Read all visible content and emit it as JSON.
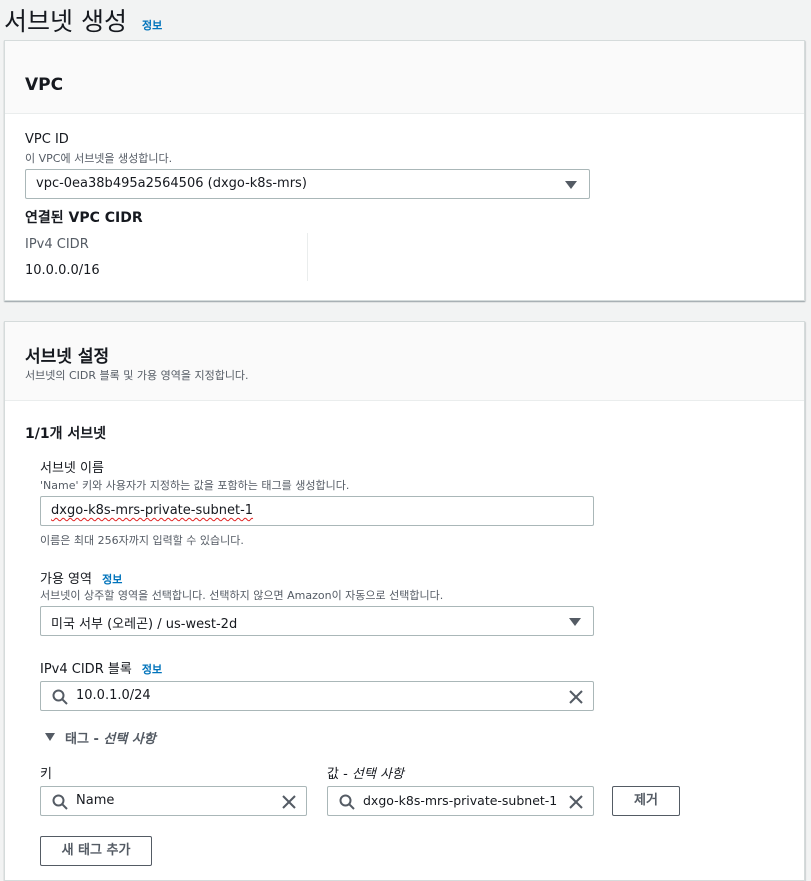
{
  "page": {
    "title": "서브넷 생성",
    "info": "정보"
  },
  "vpc_panel": {
    "heading": "VPC",
    "vpc_id_label": "VPC ID",
    "vpc_id_desc": "이 VPC에 서브넷을 생성합니다.",
    "vpc_id_value": "vpc-0ea38b495a2564506 (dxgo-k8s-mrs)",
    "cidr_heading": "연결된 VPC CIDR",
    "ipv4_cidr_label": "IPv4 CIDR",
    "ipv4_cidr_value": "10.0.0.0/16"
  },
  "subnet_panel": {
    "heading": "서브넷 설정",
    "desc": "서브넷의 CIDR 블록 및 가용 영역을 지정합니다.",
    "count_label": "1/1개 서브넷",
    "name_label": "서브넷 이름",
    "name_desc": "'Name' 키와 사용자가 지정하는 값을 포함하는 태그를 생성합니다.",
    "name_value": "dxgo-k8s-mrs-private-subnet-1",
    "name_constraint": "이름은 최대 256자까지 입력할 수 있습니다.",
    "az_label": "가용 영역",
    "az_info": "정보",
    "az_desc": "서브넷이 상주할 영역을 선택합니다. 선택하지 않으면 Amazon이 자동으로 선택합니다.",
    "az_value": "미국 서부 (오레곤) / us-west-2d",
    "cidr_label": "IPv4 CIDR 블록",
    "cidr_info": "정보",
    "cidr_value": "10.0.1.0/24",
    "tags_toggle_prefix": "태그 - ",
    "tags_toggle_optional": "선택 사항",
    "key_label": "키",
    "value_label_prefix": "값 - ",
    "value_label_optional": "선택 사항",
    "key_value": "Name",
    "tag_value": "dxgo-k8s-mrs-private-subnet-1",
    "remove_button": "제거",
    "add_tag_button": "새 태그 추가"
  },
  "colors": {
    "link": "#0073bb",
    "background": "#f2f3f3",
    "panel": "#ffffff",
    "border": "#aab7b8"
  },
  "icons": {
    "dropdown": "caret-down-icon",
    "search": "search-icon",
    "clear": "close-icon",
    "expand": "caret-down-icon"
  }
}
